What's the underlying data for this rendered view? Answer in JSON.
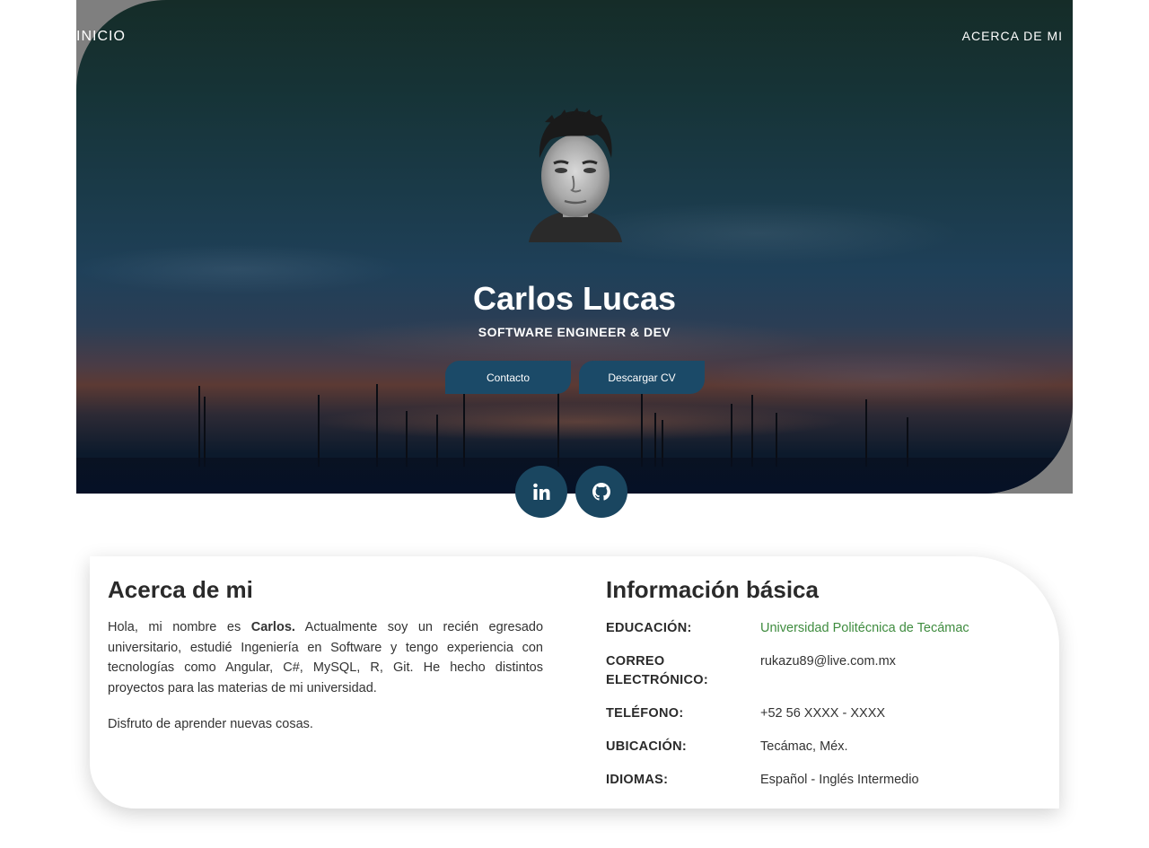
{
  "nav": {
    "home_label": "INICIO",
    "about_label": "ACERCA DE MI"
  },
  "hero": {
    "name": "Carlos Lucas",
    "title": "SOFTWARE ENGINEER & DEV",
    "buttons": {
      "contact_label": "Contacto",
      "cv_label": "Descargar CV"
    },
    "social": [
      {
        "icon": "linkedin-icon",
        "label": "in"
      },
      {
        "icon": "github-icon"
      }
    ]
  },
  "about": {
    "heading": "Acerca de mi",
    "paragraph_prefix": "Hola, mi nombre es",
    "paragraph_name": "Carlos.",
    "paragraph_rest": "Actualmente soy un recién egresado universitario, estudié Ingeniería en Software y tengo experiencia con tecnologías como Angular, C#, MySQL, R, Git. He hecho distintos proyectos para las materias de mi universidad.",
    "paragraph2": "Disfruto de aprender nuevas cosas."
  },
  "info": {
    "heading": "Información básica",
    "rows": [
      {
        "label": "EDUCACIÓN:",
        "value": "Universidad Politécnica de Tecámac"
      },
      {
        "label": "CORREO ELECTRÓNICO:",
        "value": "rukazu89@live.com.mx"
      },
      {
        "label": "TELÉFONO:",
        "value": "+52 56 XXXX - XXXX"
      },
      {
        "label": "UBICACIÓN:",
        "value": "Tecámac, Méx."
      },
      {
        "label": "IDIOMAS:",
        "value": "Español - Inglés Intermedio"
      }
    ]
  },
  "colors": {
    "accent": "#1b4a68",
    "link": "#3f8c3f",
    "text": "#333333"
  }
}
